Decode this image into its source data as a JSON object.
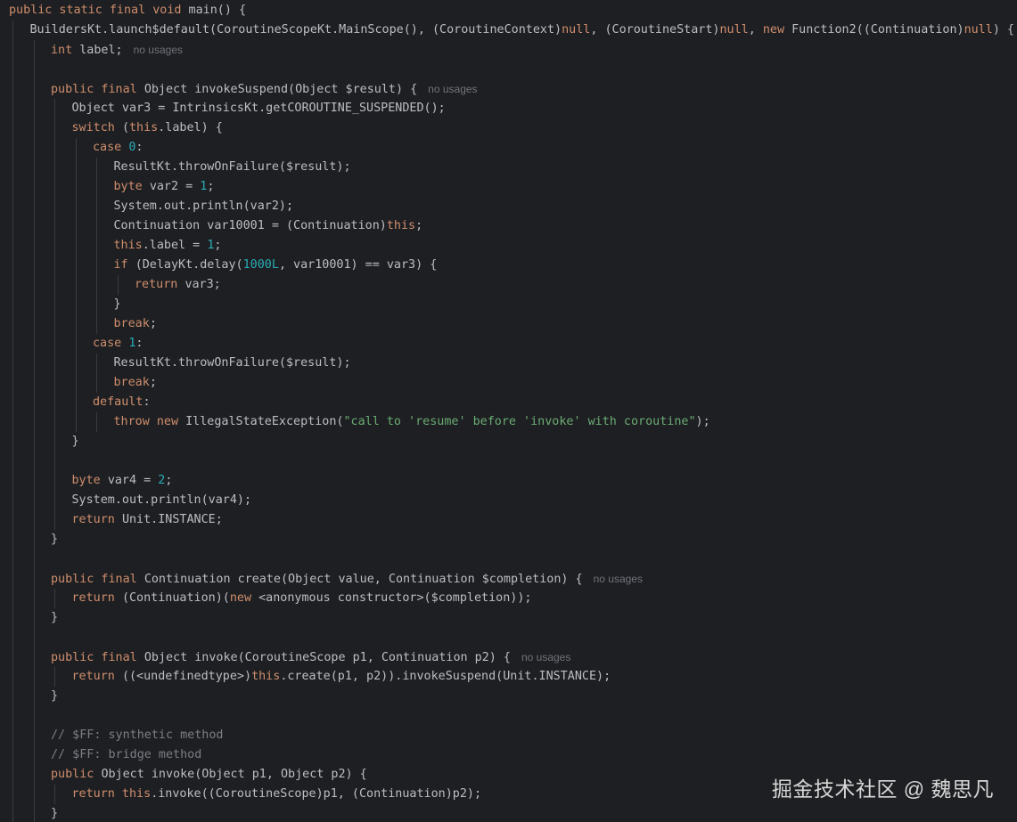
{
  "editor": {
    "language": "java",
    "theme": "dark",
    "colors": {
      "background": "#1e1f22",
      "text": "#bcbec4",
      "keyword": "#cf8e6d",
      "number": "#2aacb8",
      "string": "#6aab73",
      "comment": "#7a7e85",
      "hint": "#6f737a",
      "guide": "#393b40"
    },
    "lines": [
      {
        "indent": 0,
        "tokens": [
          [
            "kw",
            "public static final void "
          ],
          [
            "",
            "main() {"
          ]
        ]
      },
      {
        "indent": 1,
        "tokens": [
          [
            "",
            "BuildersKt.launch$default(CoroutineScopeKt.MainScope(), (CoroutineContext)"
          ],
          [
            "kw",
            "null"
          ],
          [
            "",
            ", (CoroutineStart)"
          ],
          [
            "kw",
            "null"
          ],
          [
            "",
            ", "
          ],
          [
            "kw",
            "new "
          ],
          [
            "",
            "Function2((Continuation)"
          ],
          [
            "kw",
            "null"
          ],
          [
            "",
            ") {"
          ]
        ]
      },
      {
        "indent": 2,
        "tokens": [
          [
            "kw",
            "int "
          ],
          [
            "",
            "label;"
          ]
        ],
        "hint": "no usages"
      },
      {
        "indent": 0,
        "tokens": []
      },
      {
        "indent": 2,
        "tokens": [
          [
            "kw",
            "public final "
          ],
          [
            "",
            "Object invokeSuspend(Object $result) {"
          ]
        ],
        "hint": "no usages"
      },
      {
        "indent": 3,
        "tokens": [
          [
            "",
            "Object var3 = IntrinsicsKt.getCOROUTINE_SUSPENDED();"
          ]
        ]
      },
      {
        "indent": 3,
        "tokens": [
          [
            "kw",
            "switch "
          ],
          [
            "",
            "("
          ],
          [
            "kw",
            "this"
          ],
          [
            "",
            ".label) {"
          ]
        ]
      },
      {
        "indent": 4,
        "tokens": [
          [
            "kw",
            "case "
          ],
          [
            "num",
            "0"
          ],
          [
            "",
            ":"
          ]
        ]
      },
      {
        "indent": 5,
        "tokens": [
          [
            "",
            "ResultKt.throwOnFailure($result);"
          ]
        ]
      },
      {
        "indent": 5,
        "tokens": [
          [
            "kw",
            "byte "
          ],
          [
            "",
            "var2 = "
          ],
          [
            "num",
            "1"
          ],
          [
            "",
            ";"
          ]
        ]
      },
      {
        "indent": 5,
        "tokens": [
          [
            "",
            "System.out.println(var2);"
          ]
        ]
      },
      {
        "indent": 5,
        "tokens": [
          [
            "",
            "Continuation var10001 = (Continuation)"
          ],
          [
            "kw",
            "this"
          ],
          [
            "",
            ";"
          ]
        ]
      },
      {
        "indent": 5,
        "tokens": [
          [
            "kw",
            "this"
          ],
          [
            "",
            ".label = "
          ],
          [
            "num",
            "1"
          ],
          [
            "",
            ";"
          ]
        ]
      },
      {
        "indent": 5,
        "tokens": [
          [
            "kw",
            "if "
          ],
          [
            "",
            "(DelayKt.delay("
          ],
          [
            "num",
            "1000L"
          ],
          [
            "",
            ", var10001) == var3) {"
          ]
        ]
      },
      {
        "indent": 6,
        "tokens": [
          [
            "kw",
            "return "
          ],
          [
            "",
            "var3;"
          ]
        ]
      },
      {
        "indent": 5,
        "tokens": [
          [
            "",
            "}"
          ]
        ]
      },
      {
        "indent": 5,
        "tokens": [
          [
            "kw",
            "break"
          ],
          [
            "",
            ";"
          ]
        ]
      },
      {
        "indent": 4,
        "tokens": [
          [
            "kw",
            "case "
          ],
          [
            "num",
            "1"
          ],
          [
            "",
            ":"
          ]
        ]
      },
      {
        "indent": 5,
        "tokens": [
          [
            "",
            "ResultKt.throwOnFailure($result);"
          ]
        ]
      },
      {
        "indent": 5,
        "tokens": [
          [
            "kw",
            "break"
          ],
          [
            "",
            ";"
          ]
        ]
      },
      {
        "indent": 4,
        "tokens": [
          [
            "kw",
            "default"
          ],
          [
            "",
            ":"
          ]
        ]
      },
      {
        "indent": 5,
        "tokens": [
          [
            "kw",
            "throw new "
          ],
          [
            "",
            "IllegalStateException("
          ],
          [
            "str",
            "\"call to 'resume' before 'invoke' with coroutine\""
          ],
          [
            "",
            ");"
          ]
        ]
      },
      {
        "indent": 3,
        "tokens": [
          [
            "",
            "}"
          ]
        ]
      },
      {
        "indent": 0,
        "tokens": []
      },
      {
        "indent": 3,
        "tokens": [
          [
            "kw",
            "byte "
          ],
          [
            "",
            "var4 = "
          ],
          [
            "num",
            "2"
          ],
          [
            "",
            ";"
          ]
        ]
      },
      {
        "indent": 3,
        "tokens": [
          [
            "",
            "System.out.println(var4);"
          ]
        ]
      },
      {
        "indent": 3,
        "tokens": [
          [
            "kw",
            "return "
          ],
          [
            "",
            "Unit.INSTANCE;"
          ]
        ]
      },
      {
        "indent": 2,
        "tokens": [
          [
            "",
            "}"
          ]
        ]
      },
      {
        "indent": 0,
        "tokens": []
      },
      {
        "indent": 2,
        "tokens": [
          [
            "kw",
            "public final "
          ],
          [
            "",
            "Continuation create(Object value, Continuation $completion) {"
          ]
        ],
        "hint": "no usages"
      },
      {
        "indent": 3,
        "tokens": [
          [
            "kw",
            "return "
          ],
          [
            "",
            "(Continuation)("
          ],
          [
            "kw",
            "new "
          ],
          [
            "",
            "<anonymous constructor>($completion));"
          ]
        ]
      },
      {
        "indent": 2,
        "tokens": [
          [
            "",
            "}"
          ]
        ]
      },
      {
        "indent": 0,
        "tokens": []
      },
      {
        "indent": 2,
        "tokens": [
          [
            "kw",
            "public final "
          ],
          [
            "",
            "Object invoke(CoroutineScope p1, Continuation p2) {"
          ]
        ],
        "hint": "no usages"
      },
      {
        "indent": 3,
        "tokens": [
          [
            "kw",
            "return "
          ],
          [
            "",
            "((<undefinedtype>)"
          ],
          [
            "kw",
            "this"
          ],
          [
            "",
            ".create(p1, p2)).invokeSuspend(Unit.INSTANCE);"
          ]
        ]
      },
      {
        "indent": 2,
        "tokens": [
          [
            "",
            "}"
          ]
        ]
      },
      {
        "indent": 0,
        "tokens": []
      },
      {
        "indent": 2,
        "tokens": [
          [
            "cm",
            "// $FF: synthetic method"
          ]
        ]
      },
      {
        "indent": 2,
        "tokens": [
          [
            "cm",
            "// $FF: bridge method"
          ]
        ]
      },
      {
        "indent": 2,
        "tokens": [
          [
            "kw",
            "public "
          ],
          [
            "",
            "Object invoke(Object p1, Object p2) {"
          ]
        ]
      },
      {
        "indent": 3,
        "tokens": [
          [
            "kw",
            "return this"
          ],
          [
            "",
            ".invoke((CoroutineScope)p1, (Continuation)p2);"
          ]
        ]
      },
      {
        "indent": 2,
        "tokens": [
          [
            "",
            "}"
          ]
        ]
      }
    ]
  },
  "watermark": {
    "text": "掘金技术社区 @ 魏思凡"
  }
}
